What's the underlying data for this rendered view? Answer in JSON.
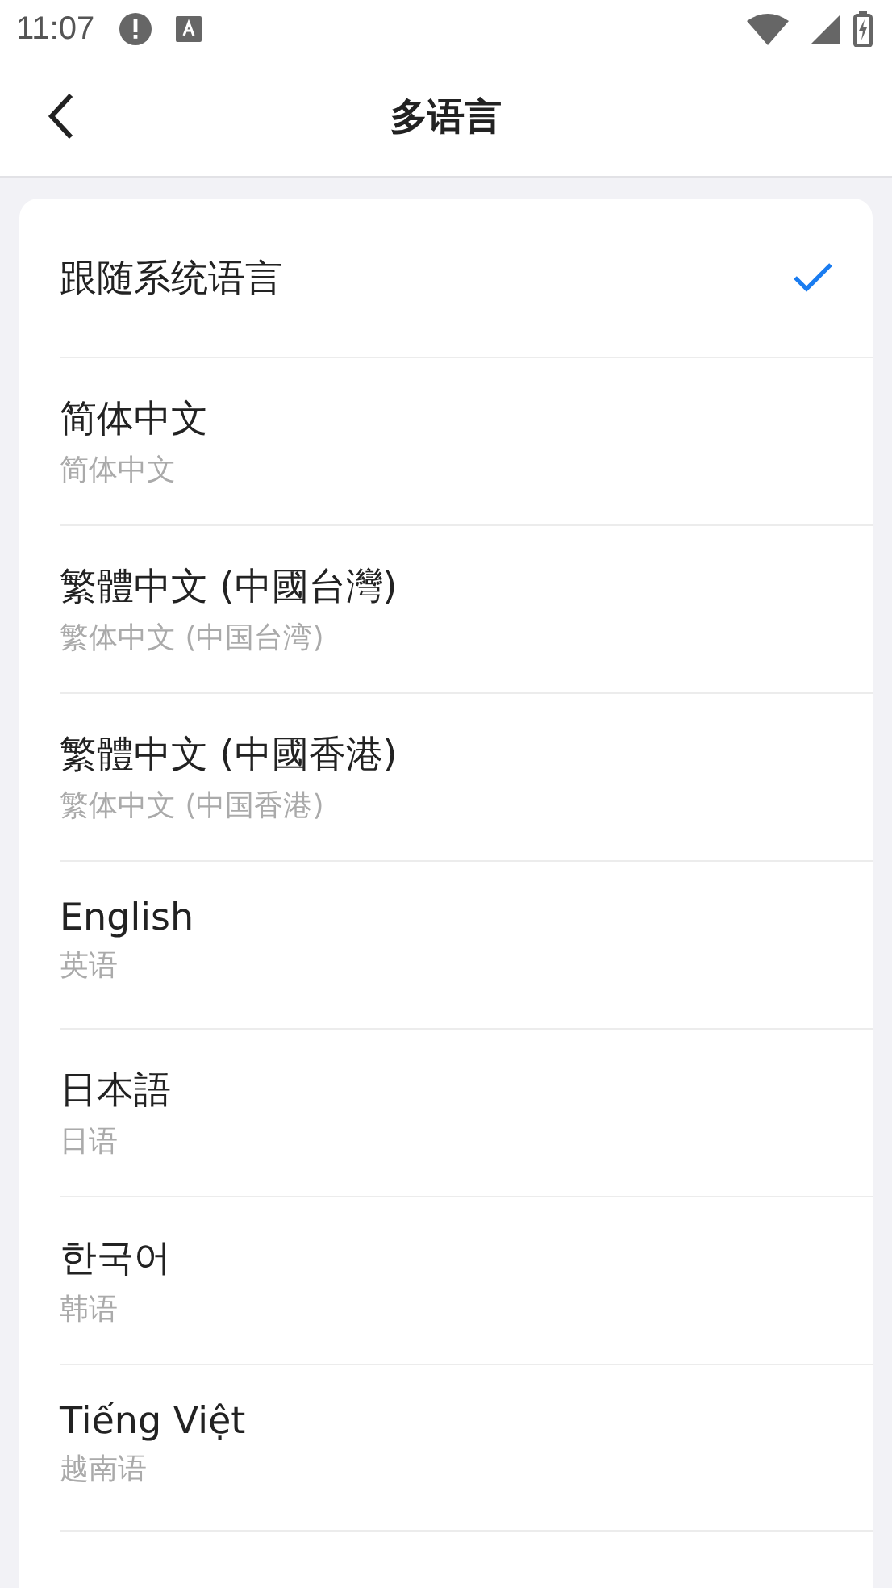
{
  "status_bar": {
    "time": "11:07"
  },
  "header": {
    "title": "多语言"
  },
  "languages": [
    {
      "name": "跟随系统语言",
      "selected": true
    },
    {
      "name": "简体中文",
      "subtitle": "简体中文",
      "selected": false
    },
    {
      "name": "繁體中文 (中國台灣)",
      "subtitle": "繁体中文 (中国台湾)",
      "selected": false
    },
    {
      "name": "繁體中文 (中國香港)",
      "subtitle": "繁体中文 (中国香港)",
      "selected": false
    },
    {
      "name": "English",
      "subtitle": "英语",
      "selected": false
    },
    {
      "name": "日本語",
      "subtitle": "日语",
      "selected": false
    },
    {
      "name": "한국어",
      "subtitle": "韩语",
      "selected": false
    },
    {
      "name": "Tiếng Việt",
      "subtitle": "越南语",
      "selected": false
    }
  ]
}
